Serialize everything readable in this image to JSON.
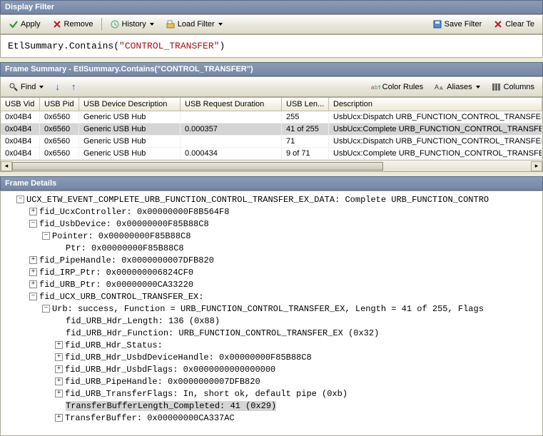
{
  "display_filter": {
    "title": "Display Filter",
    "apply": "Apply",
    "remove": "Remove",
    "history": "History",
    "load_filter": "Load Filter",
    "save_filter": "Save Filter",
    "clear": "Clear Te",
    "expr_prefix": "EtlSummary.Contains(",
    "expr_string": "\"CONTROL_TRANSFER\"",
    "expr_suffix": ")"
  },
  "frame_summary": {
    "title": "Frame Summary - EtlSummary.Contains(\"CONTROL_TRANSFER\")",
    "find": "Find",
    "color_rules": "Color Rules",
    "aliases": "Aliases",
    "columns": "Columns",
    "headers": {
      "vid": "USB Vid",
      "pid": "USB Pid",
      "desc": "USB Device Description",
      "reqdur": "USB Request Duration",
      "len": "USB Len...",
      "description": "Description"
    },
    "rows": [
      {
        "vid": "0x04B4",
        "pid": "0x6560",
        "dev": "Generic USB Hub",
        "dur": "",
        "len": "255",
        "desc": "UsbUcx:Dispatch URB_FUNCTION_CONTROL_TRANSFER_EX",
        "sel": false
      },
      {
        "vid": "0x04B4",
        "pid": "0x6560",
        "dev": "Generic USB Hub",
        "dur": "0.000357",
        "len": "41 of 255",
        "desc": "UsbUcx:Complete URB_FUNCTION_CONTROL_TRANSFER_EX with data",
        "sel": true
      },
      {
        "vid": "0x04B4",
        "pid": "0x6560",
        "dev": "Generic USB Hub",
        "dur": "",
        "len": "71",
        "desc": "UsbUcx:Dispatch URB_FUNCTION_CONTROL_TRANSFER_EX",
        "sel": false
      },
      {
        "vid": "0x04B4",
        "pid": "0x6560",
        "dev": "Generic USB Hub",
        "dur": "0.000434",
        "len": "9 of 71",
        "desc": "UsbUcx:Complete URB_FUNCTION_CONTROL_TRANSFER_EX with data",
        "sel": false
      }
    ]
  },
  "frame_details": {
    "title": "Frame Details",
    "nodes": {
      "n0": "UCX_ETW_EVENT_COMPLETE_URB_FUNCTION_CONTROL_TRANSFER_EX_DATA: Complete URB_FUNCTION_CONTRO",
      "n1": "fid_UcxController: 0x00000000F8B564F8",
      "n2": "fid_UsbDevice: 0x00000000F85B88C8",
      "n3": "Pointer: 0x00000000F85B88C8",
      "n4": "Ptr: 0x00000000F85B88C8",
      "n5": "fid_PipeHandle: 0x0000000007DFB820",
      "n6": "fid_IRP_Ptr: 0x000000006824CF0",
      "n7": "fid_URB_Ptr: 0x00000000CA33220",
      "n8": "fid_UCX_URB_CONTROL_TRANSFER_EX:",
      "n9": "Urb: success, Function = URB_FUNCTION_CONTROL_TRANSFER_EX, Length = 41 of 255, Flags ",
      "n10": "fid_URB_Hdr_Length: 136 (0x88)",
      "n11": "fid_URB_Hdr_Function: URB_FUNCTION_CONTROL_TRANSFER_EX (0x32)",
      "n12": "fid_URB_Hdr_Status:",
      "n13": "fid_URB_Hdr_UsbdDeviceHandle: 0x00000000F85B88C8",
      "n14": "fid_URB_Hdr_UsbdFlags: 0x0000000000000000",
      "n15": "fid_URB_PipeHandle: 0x0000000007DFB820",
      "n16": "fid_URB_TransferFlags: In, short ok, default pipe (0xb)",
      "n17": "TransferBufferLength_Completed: 41 (0x29)",
      "n18": "TransferBuffer: 0x00000000CA337AC"
    }
  }
}
